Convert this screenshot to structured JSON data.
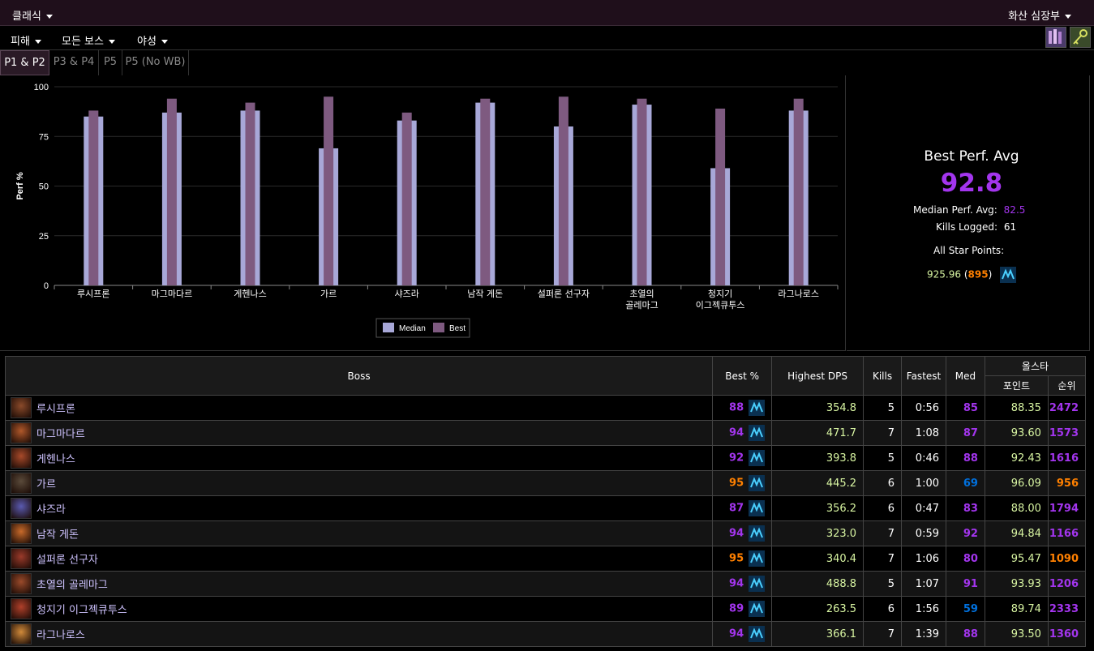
{
  "topbar": {
    "left_label": "클래식",
    "right_label": "화산 심장부"
  },
  "filters": {
    "damage": "피해",
    "bosses": "모든 보스",
    "attribute": "야성"
  },
  "tabs": [
    "P1 & P2",
    "P3 & P4",
    "P5",
    "P5 (No WB)"
  ],
  "chart_data": {
    "type": "bar",
    "ylabel": "Perf %",
    "ylim": [
      0,
      100
    ],
    "yticks": [
      0,
      25,
      50,
      75,
      100
    ],
    "categories": [
      "루시프론",
      "마그마다르",
      "게헨나스",
      "가르",
      "샤즈라",
      "남작 게돈",
      "설퍼론 선구자",
      "초열의 골레마그",
      "청지기 이그젝큐투스",
      "라그나로스"
    ],
    "category_lines": [
      [
        "루시프론"
      ],
      [
        "마그마다르"
      ],
      [
        "게헨나스"
      ],
      [
        "가르"
      ],
      [
        "샤즈라"
      ],
      [
        "남작 게돈"
      ],
      [
        "설퍼론 선구자"
      ],
      [
        "초열의",
        "골레마그"
      ],
      [
        "청지기",
        "이그젝큐투스"
      ],
      [
        "라그나로스"
      ]
    ],
    "series": [
      {
        "name": "Median",
        "color": "#a8a8d8",
        "values": [
          85,
          87,
          88,
          69,
          83,
          92,
          80,
          91,
          59,
          88
        ]
      },
      {
        "name": "Best",
        "color": "#7e5a80",
        "values": [
          88,
          94,
          92,
          95,
          87,
          94,
          95,
          94,
          89,
          94
        ]
      }
    ]
  },
  "summary": {
    "title": "Best Perf. Avg",
    "value": "92.8",
    "median_label": "Median Perf. Avg:",
    "median_value": "82.5",
    "kills_label": "Kills Logged:",
    "kills_value": "61",
    "allstar_label": "All Star Points:",
    "allstar_points": "925.96",
    "allstar_rank": "895"
  },
  "table": {
    "headers": {
      "boss": "Boss",
      "best": "Best %",
      "dps": "Highest DPS",
      "kills": "Kills",
      "fastest": "Fastest",
      "med": "Med",
      "allstar": "올스타",
      "points": "포인트",
      "rank": "순위"
    },
    "rows": [
      {
        "name": "루시프론",
        "best": "88",
        "best_color": "#a335ee",
        "dps": "354.8",
        "kills": "5",
        "fastest": "0:56",
        "med": "85",
        "med_color": "#a335ee",
        "points": "88.35",
        "rank": "2472",
        "rank_color": "#a335ee",
        "avatar": "#8a4a2a"
      },
      {
        "name": "마그마다르",
        "best": "94",
        "best_color": "#a335ee",
        "dps": "471.7",
        "kills": "7",
        "fastest": "1:08",
        "med": "87",
        "med_color": "#a335ee",
        "points": "93.60",
        "rank": "1573",
        "rank_color": "#a335ee",
        "avatar": "#b0582a"
      },
      {
        "name": "게헨나스",
        "best": "92",
        "best_color": "#a335ee",
        "dps": "393.8",
        "kills": "5",
        "fastest": "0:46",
        "med": "88",
        "med_color": "#a335ee",
        "points": "92.43",
        "rank": "1616",
        "rank_color": "#a335ee",
        "avatar": "#a84a2a"
      },
      {
        "name": "가르",
        "best": "95",
        "best_color": "#ff8000",
        "dps": "445.2",
        "kills": "6",
        "fastest": "1:00",
        "med": "69",
        "med_color": "#0070dd",
        "points": "96.09",
        "rank": "956",
        "rank_color": "#ff8000",
        "avatar": "#5a4a3a"
      },
      {
        "name": "샤즈라",
        "best": "87",
        "best_color": "#a335ee",
        "dps": "356.2",
        "kills": "6",
        "fastest": "0:47",
        "med": "83",
        "med_color": "#a335ee",
        "points": "88.00",
        "rank": "1794",
        "rank_color": "#a335ee",
        "avatar": "#5a5ab0"
      },
      {
        "name": "남작 게돈",
        "best": "94",
        "best_color": "#a335ee",
        "dps": "323.0",
        "kills": "7",
        "fastest": "0:59",
        "med": "92",
        "med_color": "#a335ee",
        "points": "94.84",
        "rank": "1166",
        "rank_color": "#a335ee",
        "avatar": "#c86a2a"
      },
      {
        "name": "설퍼론 선구자",
        "best": "95",
        "best_color": "#ff8000",
        "dps": "340.4",
        "kills": "7",
        "fastest": "1:06",
        "med": "80",
        "med_color": "#a335ee",
        "points": "95.47",
        "rank": "1090",
        "rank_color": "#ff8000",
        "avatar": "#9a3a2a"
      },
      {
        "name": "초열의 골레마그",
        "best": "94",
        "best_color": "#a335ee",
        "dps": "488.8",
        "kills": "5",
        "fastest": "1:07",
        "med": "91",
        "med_color": "#a335ee",
        "points": "93.93",
        "rank": "1206",
        "rank_color": "#a335ee",
        "avatar": "#9a4a2a"
      },
      {
        "name": "청지기 이그젝큐투스",
        "best": "89",
        "best_color": "#a335ee",
        "dps": "263.5",
        "kills": "6",
        "fastest": "1:56",
        "med": "59",
        "med_color": "#0070dd",
        "points": "89.74",
        "rank": "2333",
        "rank_color": "#a335ee",
        "avatar": "#b0402a"
      },
      {
        "name": "라그나로스",
        "best": "94",
        "best_color": "#a335ee",
        "dps": "366.1",
        "kills": "7",
        "fastest": "1:39",
        "med": "88",
        "med_color": "#a335ee",
        "points": "93.50",
        "rank": "1360",
        "rank_color": "#a335ee",
        "avatar": "#d08a3a"
      }
    ]
  }
}
